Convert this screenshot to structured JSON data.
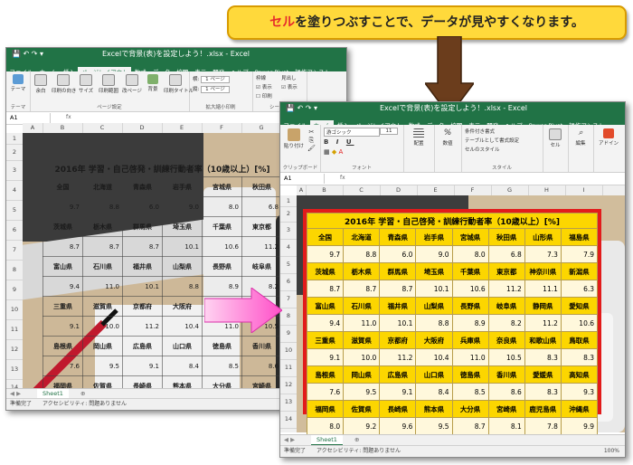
{
  "callout": {
    "accent": "セル",
    "text": "を塗りつぶすことで、データが見やすくなります。"
  },
  "back_window": {
    "title": "Excelで背景(表)を設定しよう！.xlsx - Excel",
    "tabs": [
      "ファイル",
      "ホーム",
      "挿入",
      "ページレイアウト",
      "数式",
      "データ",
      "校閲",
      "表示",
      "開発",
      "ヘルプ",
      "Power Pivot",
      "操作アシスト"
    ],
    "ribbon": {
      "theme": "テーマ",
      "margins": "余白",
      "orientation": "印刷の向き",
      "size": "サイズ",
      "print_area": "印刷範囲",
      "breaks": "改ページ",
      "background": "背景",
      "print_titles": "印刷タイトル",
      "page_setup": "ページ設定",
      "width_value": "1 ページ",
      "height_value": "1 ページ",
      "scale": "拡大縮小印刷",
      "gridlines": "枠線",
      "view": "表示",
      "print": "印刷",
      "headings": "見出し",
      "arrange": "シートの"
    },
    "name_box": "A1",
    "fx": "fx",
    "columns": [
      "A",
      "B",
      "C",
      "D",
      "E",
      "F",
      "G",
      "H"
    ],
    "rows": [
      "1",
      "2",
      "3",
      "4",
      "5",
      "6",
      "7",
      "8",
      "9",
      "10",
      "11",
      "12",
      "13",
      "14"
    ],
    "sheet_tab": "Sheet1",
    "status": "準備完了",
    "accessibility": "アクセシビリティ: 問題ありません"
  },
  "front_window": {
    "title": "Excelで背景(表)を設定しよう！.xlsx - Excel",
    "tabs": [
      "ファイル",
      "ホーム",
      "挿入",
      "ページレイアウト",
      "数式",
      "データ",
      "校閲",
      "表示",
      "開発",
      "ヘルプ",
      "Power Pivot",
      "操作アシスト"
    ],
    "ribbon": {
      "paste": "貼り付け",
      "clipboard": "クリップボード",
      "font_name": "游ゴシック",
      "font_size": "11",
      "font": "フォント",
      "align": "配置",
      "number": "数値",
      "cond_format": "条件付き書式",
      "table_format": "テーブルとして書式設定",
      "cell_styles": "セルのスタイル",
      "styles": "スタイル",
      "cells": "セル",
      "editing": "編集",
      "addin": "アドイン"
    },
    "name_box": "A1",
    "fx": "fx",
    "columns": [
      "A",
      "B",
      "C",
      "D",
      "E",
      "F",
      "G",
      "H",
      "I"
    ],
    "rows": [
      "1",
      "2",
      "3",
      "4",
      "5",
      "6",
      "7",
      "8",
      "9",
      "10",
      "11",
      "12",
      "13",
      "14"
    ],
    "sheet_tab": "Sheet1",
    "status": "準備完了",
    "accessibility": "アクセシビリティ: 問題ありません",
    "zoom": "100%"
  },
  "table": {
    "title": "2016年 学習・自己啓発・訓練行動者率（10歳以上）[%]",
    "rows": [
      {
        "names": [
          "全国",
          "北海道",
          "青森県",
          "岩手県",
          "宮城県",
          "秋田県",
          "山形県",
          "福島県"
        ],
        "values": [
          "9.7",
          "8.8",
          "6.0",
          "9.0",
          "8.0",
          "6.8",
          "7.3",
          "7.9"
        ]
      },
      {
        "names": [
          "茨城県",
          "栃木県",
          "群馬県",
          "埼玉県",
          "千葉県",
          "東京都",
          "神奈川県",
          "新潟県"
        ],
        "values": [
          "8.7",
          "8.7",
          "8.7",
          "10.1",
          "10.6",
          "11.2",
          "11.1",
          "6.3"
        ]
      },
      {
        "names": [
          "富山県",
          "石川県",
          "福井県",
          "山梨県",
          "長野県",
          "岐阜県",
          "静岡県",
          "愛知県"
        ],
        "values": [
          "9.4",
          "11.0",
          "10.1",
          "8.8",
          "8.9",
          "8.2",
          "11.2",
          "10.6"
        ]
      },
      {
        "names": [
          "三重県",
          "滋賀県",
          "京都府",
          "大阪府",
          "兵庫県",
          "奈良県",
          "和歌山県",
          "鳥取県"
        ],
        "values": [
          "9.1",
          "10.0",
          "11.2",
          "10.4",
          "11.0",
          "10.5",
          "8.3",
          "8.3"
        ]
      },
      {
        "names": [
          "島根県",
          "岡山県",
          "広島県",
          "山口県",
          "徳島県",
          "香川県",
          "愛媛県",
          "高知県"
        ],
        "values": [
          "7.6",
          "9.5",
          "9.1",
          "8.4",
          "8.5",
          "8.6",
          "8.3",
          "9.3"
        ]
      },
      {
        "names": [
          "福岡県",
          "佐賀県",
          "長崎県",
          "熊本県",
          "大分県",
          "宮崎県",
          "鹿児島県",
          "沖縄県"
        ],
        "values": [
          "8.0",
          "9.2",
          "9.6",
          "9.5",
          "8.7",
          "8.1",
          "7.8",
          "9.9"
        ]
      }
    ]
  },
  "colors": {
    "excel_green": "#217346",
    "highlight": "#fcd600",
    "frame_red": "#e21b1b",
    "arrow_pink": "#ff5fd0"
  }
}
